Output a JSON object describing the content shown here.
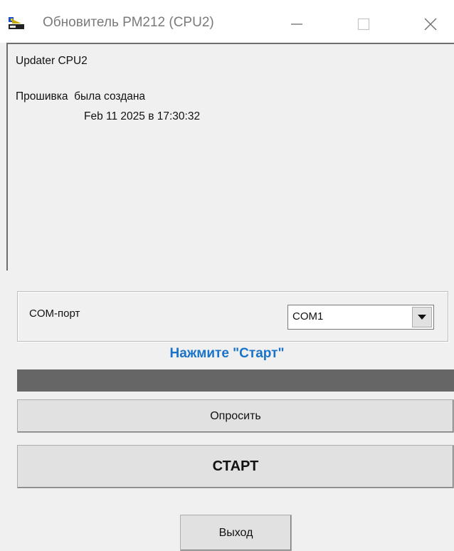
{
  "window": {
    "title": "Обновитель РМ212 (CPU2)",
    "app_icon": "updater-app-icon",
    "controls": {
      "minimize_icon": "minimize-icon",
      "maximize_icon": "maximize-icon",
      "close_icon": "close-icon"
    }
  },
  "log": {
    "lines": [
      "Updater CPU2",
      "Прошивка  была создана",
      "Feb 11 2025 в 17:30:32"
    ]
  },
  "com": {
    "label": "COM-порт",
    "selected": "COM1"
  },
  "status": {
    "text": "Нажмите \"Старт\"",
    "color": "#1a73c9"
  },
  "progress": {
    "value": 0
  },
  "buttons": {
    "poll": "Опросить",
    "start": "СТАРТ",
    "exit": "Выход"
  }
}
